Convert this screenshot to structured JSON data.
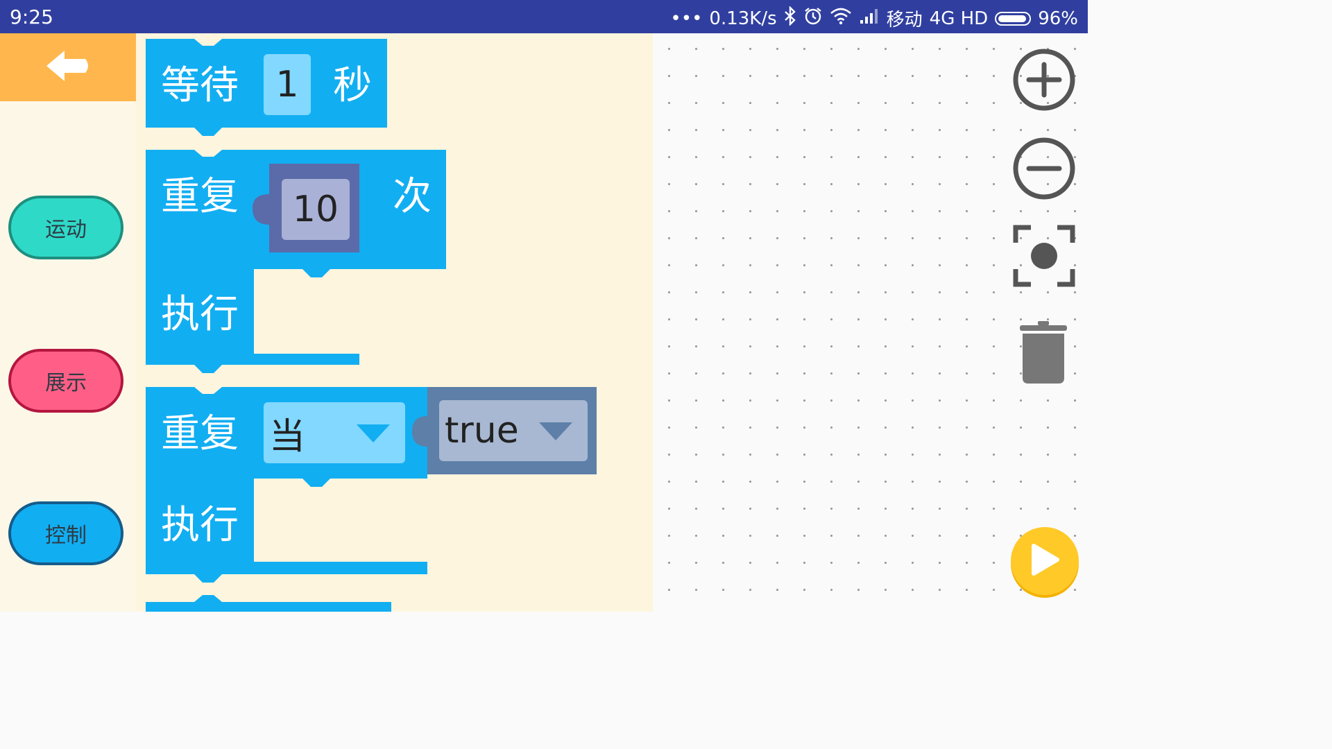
{
  "status_bar": {
    "time": "9:25",
    "dots": "•••",
    "net_speed": "0.13K/s",
    "carrier": "移动",
    "network": "4G HD",
    "battery": "96%",
    "icons": [
      "bluetooth-icon",
      "alarm-icon",
      "wifi-icon",
      "signal-icon",
      "battery-icon"
    ]
  },
  "sidebar": {
    "back_icon": "arrow-left-icon",
    "categories": [
      {
        "label": "运动",
        "color": "#2fd9c8"
      },
      {
        "label": "展示",
        "color": "#ff5f86"
      },
      {
        "label": "控制",
        "color": "#12aef2"
      }
    ]
  },
  "flyout": {
    "block_color": "#12aef2",
    "wait_block": {
      "label": "等待",
      "value": "1",
      "unit": "秒"
    },
    "repeat_times_block": {
      "label": "重复",
      "value": "10",
      "unit": "次",
      "do_label": "执行"
    },
    "repeat_while_block": {
      "label": "重复",
      "mode": "当",
      "condition": "true",
      "do_label": "执行"
    }
  },
  "workspace": {
    "controls": [
      "zoom-in-icon",
      "zoom-out-icon",
      "recenter-icon",
      "trash-icon"
    ],
    "run_button_icon": "play-icon",
    "run_color": "#ffc928"
  }
}
